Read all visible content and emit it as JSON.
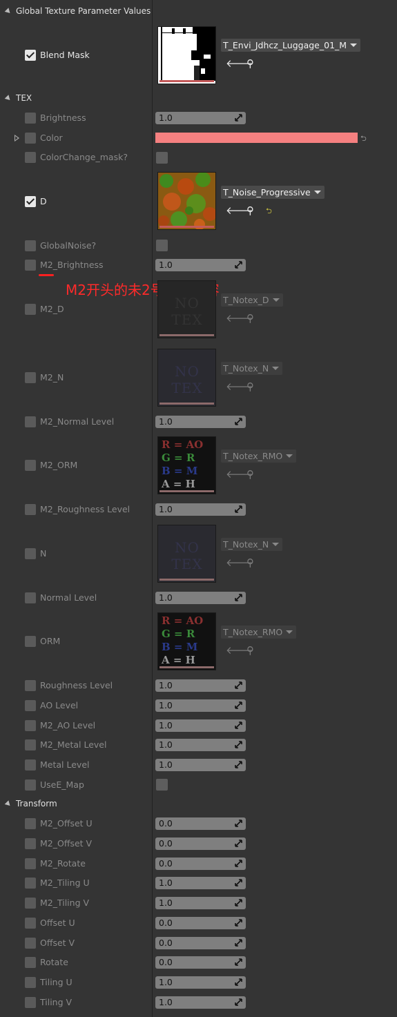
{
  "sections": {
    "global": "Global Texture Parameter Values",
    "tex": "TEX",
    "transform": "Transform"
  },
  "annotation": "M2开头的未2号材质内容",
  "colors": {
    "color_swatch": "#f58080",
    "annotation": "#ff2a2a"
  },
  "icons": {
    "back": "left-arrow-icon",
    "browse": "magnifier-icon",
    "reset": "reset-arrow-icon"
  },
  "textures": {
    "blend_mask": "T_Envi_Jdhcz_Luggage_01_M",
    "d": "T_Noise_Progressive",
    "m2_d": "T_Notex_D",
    "m2_n": "T_Notex_N",
    "m2_orm": "T_Notex_RMO",
    "n": "T_Notex_N",
    "orm": "T_Notex_RMO"
  },
  "labels": {
    "blend_mask": "Blend Mask",
    "brightness": "Brightness",
    "color": "Color",
    "colorchange_mask": "ColorChange_mask?",
    "d": "D",
    "globalnoise": "GlobalNoise?",
    "m2_brightness": "M2_Brightness",
    "m2_d": "M2_D",
    "m2_n": "M2_N",
    "m2_normal_level": "M2_Normal Level",
    "m2_orm": "M2_ORM",
    "m2_roughness_level": "M2_Roughness Level",
    "n": "N",
    "normal_level": "Normal Level",
    "orm": "ORM",
    "roughness_level": "Roughness Level",
    "ao_level": "AO Level",
    "m2_ao_level": "M2_AO Level",
    "m2_metal_level": "M2_Metal Level",
    "metal_level": "Metal Level",
    "usee_map": "UseE_Map",
    "m2_offset_u": "M2_Offset U",
    "m2_offset_v": "M2_Offset V",
    "m2_rotate": "M2_Rotate",
    "m2_tiling_u": "M2_Tiling U",
    "m2_tiling_v": "M2_Tiling V",
    "offset_u": "Offset U",
    "offset_v": "Offset V",
    "rotate": "Rotate",
    "tiling_u": "Tiling U",
    "tiling_v": "Tiling V"
  },
  "values": {
    "brightness": "1.0",
    "m2_brightness": "1.0",
    "m2_normal_level": "1.0",
    "m2_roughness_level": "1.0",
    "normal_level": "1.0",
    "roughness_level": "1.0",
    "ao_level": "1.0",
    "m2_ao_level": "1.0",
    "m2_metal_level": "1.0",
    "metal_level": "1.0",
    "m2_offset_u": "0.0",
    "m2_offset_v": "0.0",
    "m2_rotate": "0.0",
    "m2_tiling_u": "1.0",
    "m2_tiling_v": "1.0",
    "offset_u": "0.0",
    "offset_v": "0.0",
    "rotate": "0.0",
    "tiling_u": "1.0",
    "tiling_v": "1.0"
  },
  "thumb_text": {
    "notex": "NO TEX",
    "rmo_r": "R = AO",
    "rmo_g": "G = R",
    "rmo_b": "B = M",
    "rmo_a": "A = H"
  }
}
